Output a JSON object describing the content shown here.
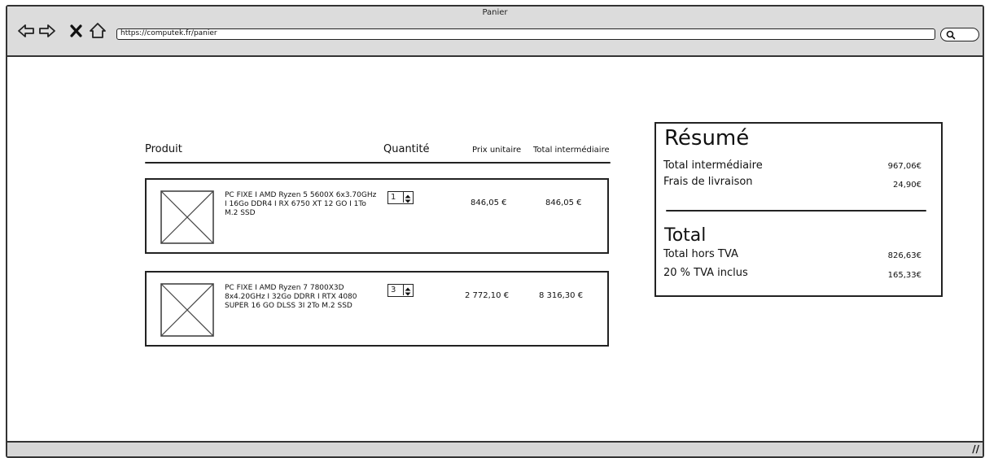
{
  "window": {
    "title": "Panier",
    "url": "https://computek.fr/panier"
  },
  "nav": {
    "back_icon": "back-arrow-icon",
    "forward_icon": "forward-arrow-icon",
    "stop_icon": "close-icon",
    "home_icon": "home-icon",
    "search_icon": "search-icon"
  },
  "table_header": {
    "product": "Produit",
    "quantity": "Quantité",
    "unit_price": "Prix unitaire",
    "subtotal": "Total intermédiaire"
  },
  "items": [
    {
      "name": "PC FIXE I AMD Ryzen 5 5600X 6x3.70GHz I 16Go DDR4 I RX 6750 XT 12 GO I 1To M.2 SSD",
      "quantity": "1",
      "unit_price": "846,05 €",
      "subtotal": "846,05 €"
    },
    {
      "name": "PC FIXE I AMD Ryzen 7 7800X3D 8x4.20GHz I 32Go DDRR I RTX 4080 SUPER 16 GO DLSS 3I 2To M.2 SSD",
      "quantity": "3",
      "unit_price": "2 772,10 €",
      "subtotal": "8 316,30 €"
    }
  ],
  "summary": {
    "heading": "Résumé",
    "subtotal_label": "Total intermédiaire",
    "subtotal_value": "967,06€",
    "shipping_label": "Frais de livraison",
    "shipping_value": "24,90€",
    "total_heading": "Total",
    "ht_label": "Total hors TVA",
    "ht_value": "826,63€",
    "vat_label": "20 % TVA inclus",
    "vat_value": "165,33€"
  },
  "statusbar": {
    "grip": "//"
  }
}
